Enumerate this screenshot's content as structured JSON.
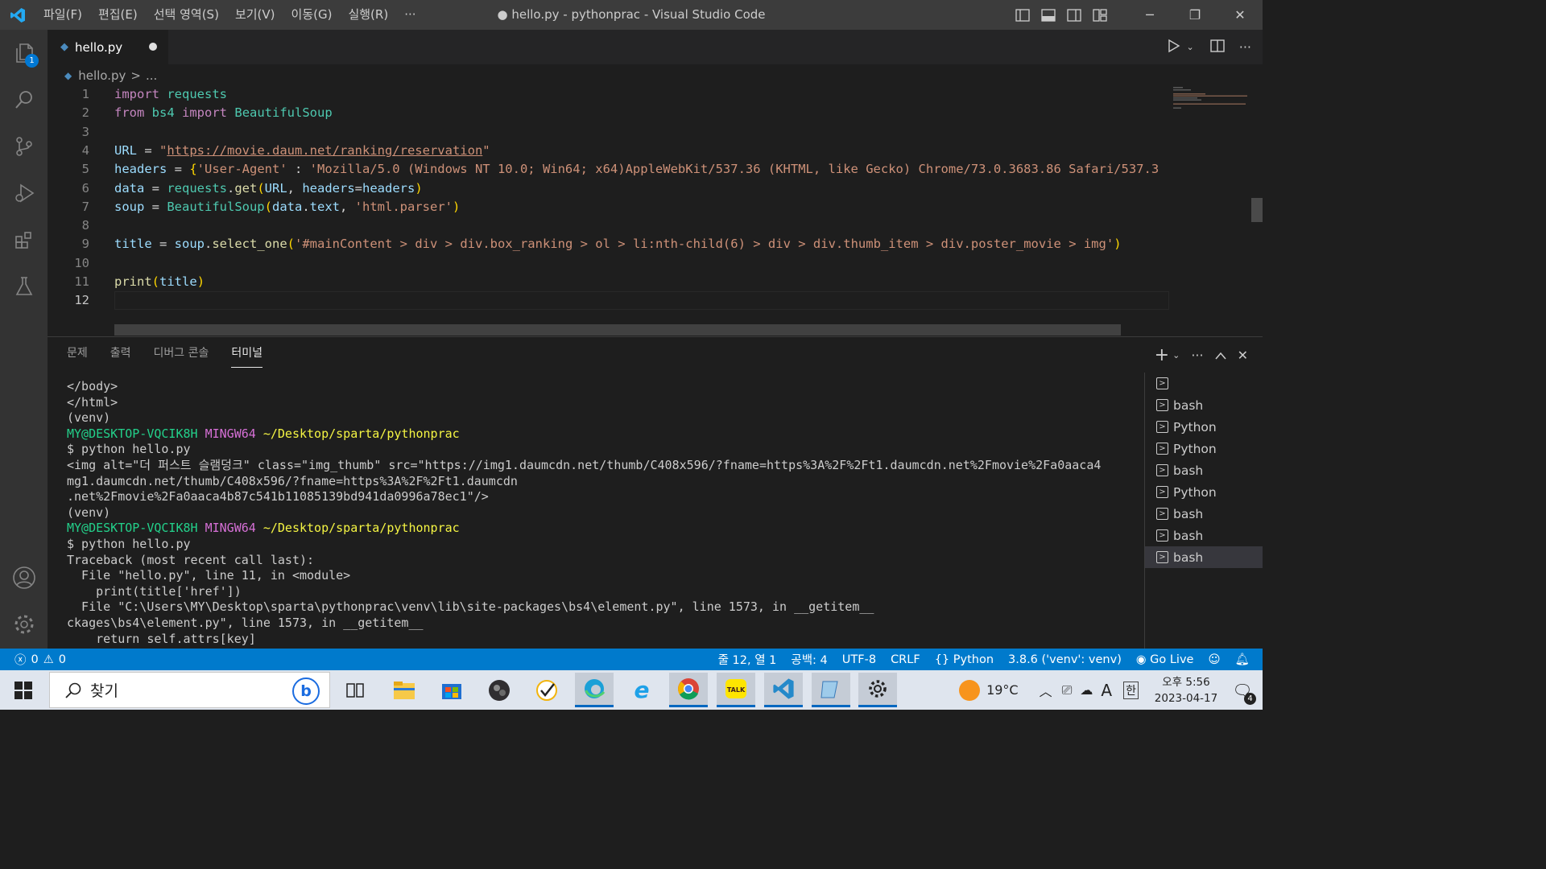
{
  "window": {
    "title": "● hello.py - pythonprac - Visual Studio Code",
    "menu": [
      "파일(F)",
      "편집(E)",
      "선택 영역(S)",
      "보기(V)",
      "이동(G)",
      "실행(R)",
      "···"
    ]
  },
  "activity_bar": {
    "explorer_badge": "1",
    "items": [
      "files-icon",
      "search-icon",
      "source-control-icon",
      "run-debug-icon",
      "extensions-icon",
      "testing-icon"
    ],
    "bottom": [
      "account-icon",
      "settings-gear-icon"
    ]
  },
  "editor": {
    "tab": {
      "label": "hello.py",
      "modified": true
    },
    "breadcrumb": {
      "file": "hello.py",
      "sep": ">",
      "more": "..."
    },
    "lines": [
      {
        "num": "1",
        "text": "import requests"
      },
      {
        "num": "2",
        "text": "from bs4 import BeautifulSoup"
      },
      {
        "num": "3",
        "text": ""
      },
      {
        "num": "4",
        "text": "URL = \"https://movie.daum.net/ranking/reservation\""
      },
      {
        "num": "5",
        "text": "headers = {'User-Agent' : 'Mozilla/5.0 (Windows NT 10.0; Win64; x64)AppleWebKit/537.36 (KHTML, like Gecko) Chrome/73.0.3683.86 Safari/537.3"
      },
      {
        "num": "6",
        "text": "data = requests.get(URL, headers=headers)"
      },
      {
        "num": "7",
        "text": "soup = BeautifulSoup(data.text, 'html.parser')"
      },
      {
        "num": "8",
        "text": ""
      },
      {
        "num": "9",
        "text": "title = soup.select_one('#mainContent > div > div.box_ranking > ol > li:nth-child(6) > div > div.thumb_item > div.poster_movie > img')"
      },
      {
        "num": "10",
        "text": ""
      },
      {
        "num": "11",
        "text": "print(title)"
      },
      {
        "num": "12",
        "text": ""
      }
    ]
  },
  "panel": {
    "tabs": [
      "문제",
      "출력",
      "디버그 콘솔",
      "터미널"
    ],
    "active_tab": "터미널",
    "terminal_lines": [
      "</body>",
      "</html>",
      "(venv)",
      "PROMPT",
      "$ python hello.py",
      "<img alt=\"더 퍼스트 슬램덩크\" class=\"img_thumb\" src=\"https://img1.daumcdn.net/thumb/C408x596/?fname=https%3A%2F%2Ft1.daumcdn.net%2Fmovie%2Fa0aaca4",
      "mg1.daumcdn.net/thumb/C408x596/?fname=https%3A%2F%2Ft1.daumcdn",
      ".net%2Fmovie%2Fa0aaca4b87c541b11085139bd941da0996a78ec1\"/>",
      "(venv)",
      "PROMPT",
      "$ python hello.py",
      "Traceback (most recent call last):",
      "  File \"hello.py\", line 11, in <module>",
      "    print(title['href'])",
      "  File \"C:\\Users\\MY\\Desktop\\sparta\\pythonprac\\venv\\lib\\site-packages\\bs4\\element.py\", line 1573, in __getitem__",
      "ckages\\bs4\\element.py\", line 1573, in __getitem__",
      "    return self.attrs[key]"
    ],
    "prompt": {
      "user": "MY@DESKTOP-VQCIK8H",
      "shell": "MINGW64",
      "path": "~/Desktop/sparta/pythonprac"
    },
    "terminal_list": [
      {
        "label": "",
        "selected": false
      },
      {
        "label": "bash",
        "selected": false
      },
      {
        "label": "Python",
        "selected": false
      },
      {
        "label": "Python",
        "selected": false
      },
      {
        "label": "bash",
        "selected": false
      },
      {
        "label": "Python",
        "selected": false
      },
      {
        "label": "bash",
        "selected": false
      },
      {
        "label": "bash",
        "selected": false
      },
      {
        "label": "bash",
        "selected": true
      }
    ]
  },
  "status_bar": {
    "errors": "0",
    "warnings": "0",
    "position": "줄 12, 열 1",
    "spaces": "공백: 4",
    "encoding": "UTF-8",
    "eol": "CRLF",
    "language": "Python",
    "interpreter": "3.8.6 ('venv': venv)",
    "golive": "Go Live"
  },
  "taskbar": {
    "search_placeholder": "찾기",
    "weather": "19°C",
    "ime_mode": "A",
    "ime_lang": "한",
    "time": "오후 5:56",
    "date": "2023-04-17",
    "notifications": "4"
  },
  "colors": {
    "statusbar": "#007acc",
    "activitybar": "#333333",
    "editor_bg": "#1e1e1e",
    "accent": "#0078d4"
  }
}
